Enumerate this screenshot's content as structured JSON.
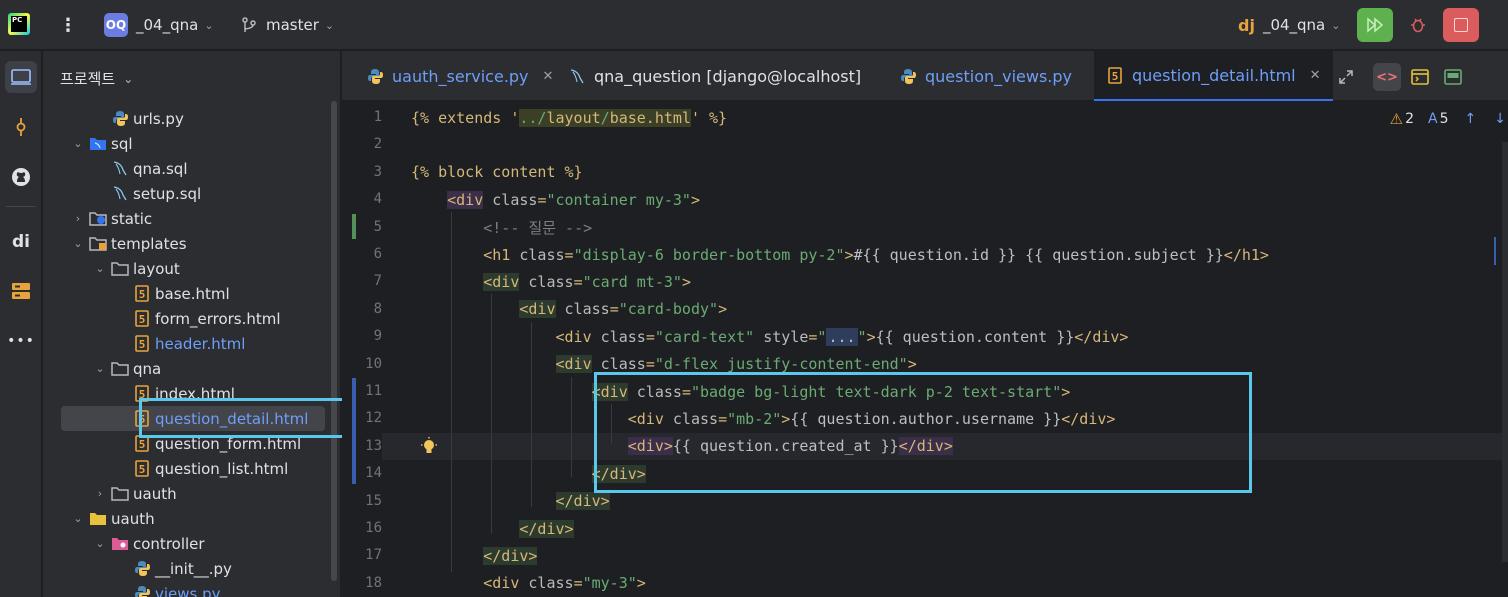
{
  "titlebar": {
    "app_logo_text": "PC",
    "menu_icon": "kebab-menu-icon",
    "project_badge": "OQ",
    "project_name": "_04_qna",
    "branch_name": "master",
    "run_config_name": "_04_qna",
    "colors": {
      "run": "#5fb14f",
      "stop": "#db5c5c",
      "debug": "#db5c5c"
    }
  },
  "toolstrip": {
    "items": [
      "project-icon",
      "commit-icon",
      "github-icon",
      "django-structure-icon",
      "services-icon",
      "more-tools-icon"
    ],
    "more_label": "•••"
  },
  "project_panel": {
    "title": "프로젝트",
    "tree": [
      {
        "label": "urls.py",
        "icon": "python-file-icon",
        "depth": 3,
        "arrow": ""
      },
      {
        "label": "sql",
        "icon": "sql-folder-icon",
        "depth": 2,
        "arrow": "⌄"
      },
      {
        "label": "qna.sql",
        "icon": "sql-file-icon",
        "depth": 3,
        "arrow": ""
      },
      {
        "label": "setup.sql",
        "icon": "sql-file-icon",
        "depth": 3,
        "arrow": ""
      },
      {
        "label": "static",
        "icon": "static-folder-icon",
        "depth": 2,
        "arrow": "›"
      },
      {
        "label": "templates",
        "icon": "templates-folder-icon",
        "depth": 2,
        "arrow": "⌄"
      },
      {
        "label": "layout",
        "icon": "folder-icon",
        "depth": 3,
        "arrow": "⌄"
      },
      {
        "label": "base.html",
        "icon": "html-file-icon",
        "depth": 4,
        "arrow": ""
      },
      {
        "label": "form_errors.html",
        "icon": "html-file-icon",
        "depth": 4,
        "arrow": ""
      },
      {
        "label": "header.html",
        "icon": "html-file-icon",
        "depth": 4,
        "arrow": "",
        "modified": true
      },
      {
        "label": "qna",
        "icon": "folder-icon",
        "depth": 3,
        "arrow": "⌄"
      },
      {
        "label": "index.html",
        "icon": "html-file-icon",
        "depth": 4,
        "arrow": ""
      },
      {
        "label": "question_detail.html",
        "icon": "html-file-icon",
        "depth": 4,
        "arrow": "",
        "selected": true,
        "modified": true
      },
      {
        "label": "question_form.html",
        "icon": "html-file-icon",
        "depth": 4,
        "arrow": ""
      },
      {
        "label": "question_list.html",
        "icon": "html-file-icon",
        "depth": 4,
        "arrow": ""
      },
      {
        "label": "uauth",
        "icon": "folder-icon",
        "depth": 3,
        "arrow": "›"
      },
      {
        "label": "uauth",
        "icon": "package-folder-icon",
        "depth": 2,
        "arrow": "⌄"
      },
      {
        "label": "controller",
        "icon": "controller-folder-icon",
        "depth": 3,
        "arrow": "⌄"
      },
      {
        "label": "__init__.py",
        "icon": "python-file-icon",
        "depth": 4,
        "arrow": ""
      },
      {
        "label": "views.py",
        "icon": "python-file-icon",
        "depth": 4,
        "arrow": "",
        "modified": true
      }
    ]
  },
  "tabs": [
    {
      "label": "uauth_service.py",
      "icon": "python-file-icon",
      "closable": true,
      "modified": true
    },
    {
      "label": "qna_question [django@localhost]",
      "icon": "sql-file-icon",
      "closable": false
    },
    {
      "label": "question_views.py",
      "icon": "python-file-icon",
      "closable": false,
      "modified": true
    },
    {
      "label": "question_detail.html",
      "icon": "html-file-icon",
      "closable": true,
      "active": true,
      "modified": true
    }
  ],
  "tab_close_glyph": "✕",
  "editor": {
    "warnings": "2",
    "typos": "5",
    "lines": [
      {
        "n": "1",
        "segments": [
          [
            "tpl",
            "{% extends '"
          ],
          [
            "hl",
            "../"
          ],
          [
            "hltag",
            "layout"
          ],
          [
            "hl",
            "/"
          ],
          [
            "hltag",
            "base.html"
          ],
          [
            "tpl",
            "' %}"
          ]
        ]
      },
      {
        "n": "2",
        "segments": []
      },
      {
        "n": "3",
        "segments": [
          [
            "tpl",
            "{% block content %}"
          ]
        ]
      },
      {
        "n": "4",
        "segments": [
          [
            "ind",
            "    "
          ],
          [
            "tagbg2",
            "<div"
          ],
          [
            "attr",
            " class"
          ],
          [
            "tag",
            "="
          ],
          [
            "str",
            "\"container my-3\""
          ],
          [
            "tag",
            ">"
          ]
        ]
      },
      {
        "n": "5",
        "segments": [
          [
            "ind",
            "        "
          ],
          [
            "cmt",
            "<!-- 질문 -->"
          ]
        ]
      },
      {
        "n": "6",
        "segments": [
          [
            "ind",
            "        "
          ],
          [
            "tag",
            "<h1"
          ],
          [
            "attr",
            " class"
          ],
          [
            "tag",
            "="
          ],
          [
            "str",
            "\"display-6 border-bottom py-2\""
          ],
          [
            "tag",
            ">"
          ],
          [
            "text",
            "#{{ question.id }} {{ question.subject }}"
          ],
          [
            "tag",
            "</h1>"
          ]
        ]
      },
      {
        "n": "7",
        "segments": [
          [
            "ind",
            "        "
          ],
          [
            "tagbg",
            "<div"
          ],
          [
            "attr",
            " class"
          ],
          [
            "tag",
            "="
          ],
          [
            "str",
            "\"card mt-3\""
          ],
          [
            "tag",
            ">"
          ]
        ]
      },
      {
        "n": "8",
        "segments": [
          [
            "ind",
            "            "
          ],
          [
            "tagbg",
            "<div"
          ],
          [
            "attr",
            " class"
          ],
          [
            "tag",
            "="
          ],
          [
            "str",
            "\"card-body\""
          ],
          [
            "tag",
            ">"
          ]
        ]
      },
      {
        "n": "9",
        "segments": [
          [
            "ind",
            "                "
          ],
          [
            "tag",
            "<div"
          ],
          [
            "attr",
            " class"
          ],
          [
            "tag",
            "="
          ],
          [
            "str",
            "\"card-text\""
          ],
          [
            "attr",
            " style"
          ],
          [
            "tag",
            "="
          ],
          [
            "str",
            "\""
          ],
          [
            "fold",
            "..."
          ],
          [
            "str",
            "\""
          ],
          [
            "tag",
            ">"
          ],
          [
            "text",
            "{{ question.content }}"
          ],
          [
            "tag",
            "</div>"
          ]
        ]
      },
      {
        "n": "10",
        "segments": [
          [
            "ind",
            "                "
          ],
          [
            "tagbg",
            "<div"
          ],
          [
            "attr",
            " class"
          ],
          [
            "tag",
            "="
          ],
          [
            "str",
            "\"d-flex justify-content-end\""
          ],
          [
            "tag",
            ">"
          ]
        ]
      },
      {
        "n": "11",
        "segments": [
          [
            "ind",
            "                    "
          ],
          [
            "tagbg",
            "<div"
          ],
          [
            "attr",
            " class"
          ],
          [
            "tag",
            "="
          ],
          [
            "str",
            "\"badge bg-light text-dark p-2 text-start\""
          ],
          [
            "tag",
            ">"
          ]
        ]
      },
      {
        "n": "12",
        "segments": [
          [
            "ind",
            "                        "
          ],
          [
            "tag",
            "<div"
          ],
          [
            "attr",
            " class"
          ],
          [
            "tag",
            "="
          ],
          [
            "str",
            "\"mb-2\""
          ],
          [
            "tag",
            ">"
          ],
          [
            "text",
            "{{ question.author.username }}"
          ],
          [
            "tag",
            "</div>"
          ]
        ]
      },
      {
        "n": "13",
        "segments": [
          [
            "ind",
            "                        "
          ],
          [
            "tagbg2",
            "<div>"
          ],
          [
            "text",
            "{{ question.created_at }}"
          ],
          [
            "tagbg2",
            "</div>"
          ]
        ]
      },
      {
        "n": "14",
        "segments": [
          [
            "ind",
            "                    "
          ],
          [
            "tagbg",
            "</div>"
          ]
        ]
      },
      {
        "n": "15",
        "segments": [
          [
            "ind",
            "                "
          ],
          [
            "tagbg",
            "</div>"
          ]
        ]
      },
      {
        "n": "16",
        "segments": [
          [
            "ind",
            "            "
          ],
          [
            "tagbg",
            "</div>"
          ]
        ]
      },
      {
        "n": "17",
        "segments": [
          [
            "ind",
            "        "
          ],
          [
            "tagbg",
            "</div>"
          ]
        ]
      },
      {
        "n": "18",
        "segments": [
          [
            "ind",
            "        "
          ],
          [
            "tag",
            "<div"
          ],
          [
            "attr",
            " class"
          ],
          [
            "tag",
            "="
          ],
          [
            "str",
            "\"my-3\""
          ],
          [
            "tag",
            ">"
          ]
        ]
      }
    ]
  },
  "colors": {
    "accent": "#3574f0",
    "highlight_box": "#5ac8ec",
    "modified_file": "#6f9ef8"
  }
}
